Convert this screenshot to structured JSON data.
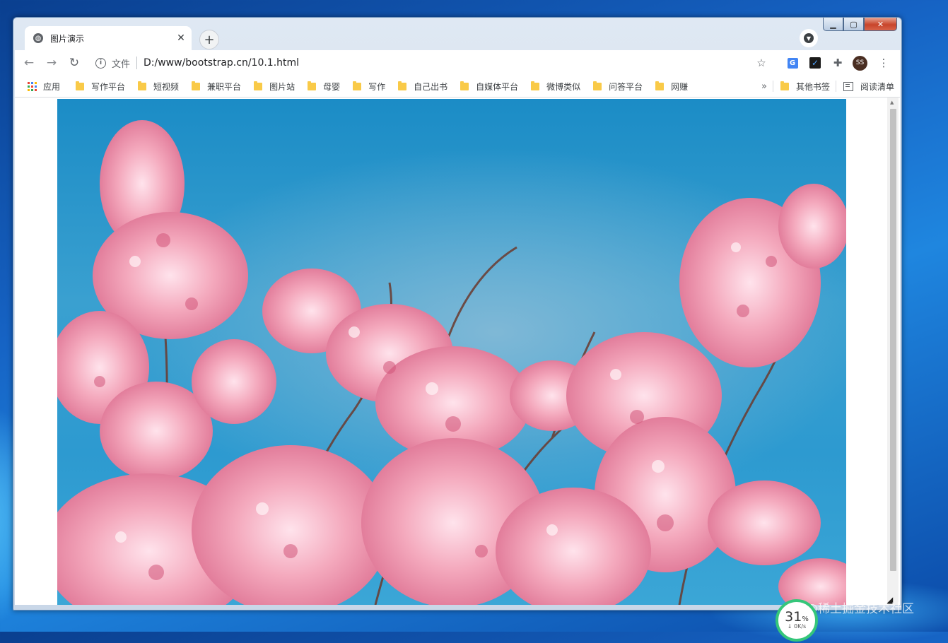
{
  "browser": {
    "tab": {
      "title": "图片演示",
      "close": "✕"
    },
    "new_tab": "+",
    "window_controls": {
      "minimize": "▁",
      "maximize": "▢",
      "close": "✕"
    },
    "address": {
      "scheme_label": "文件",
      "url": "D:/www/bootstrap.cn/10.1.html"
    },
    "profile_initials": "SS",
    "bookmarks": {
      "apps": "应用",
      "folders": [
        "写作平台",
        "短视频",
        "兼职平台",
        "图片站",
        "母婴",
        "写作",
        "自己出书",
        "自媒体平台",
        "微博类似",
        "问答平台",
        "网赚"
      ],
      "overflow": "»",
      "other": "其他书签",
      "reading_list": "阅读清单"
    }
  },
  "page": {
    "image_subject": "pink cherry blossoms against blue sky"
  },
  "overlay": {
    "speed_percent": "31",
    "speed_unit": "%",
    "speed_sub": "↓ 0K/s",
    "watermark": "@稀土掘金技术社区"
  },
  "colors": {
    "sky_top": "#1b8cc6",
    "blossom": "#f4a9bd",
    "blossom_dark": "#d2567a",
    "speed_ring": "#35c67a"
  }
}
